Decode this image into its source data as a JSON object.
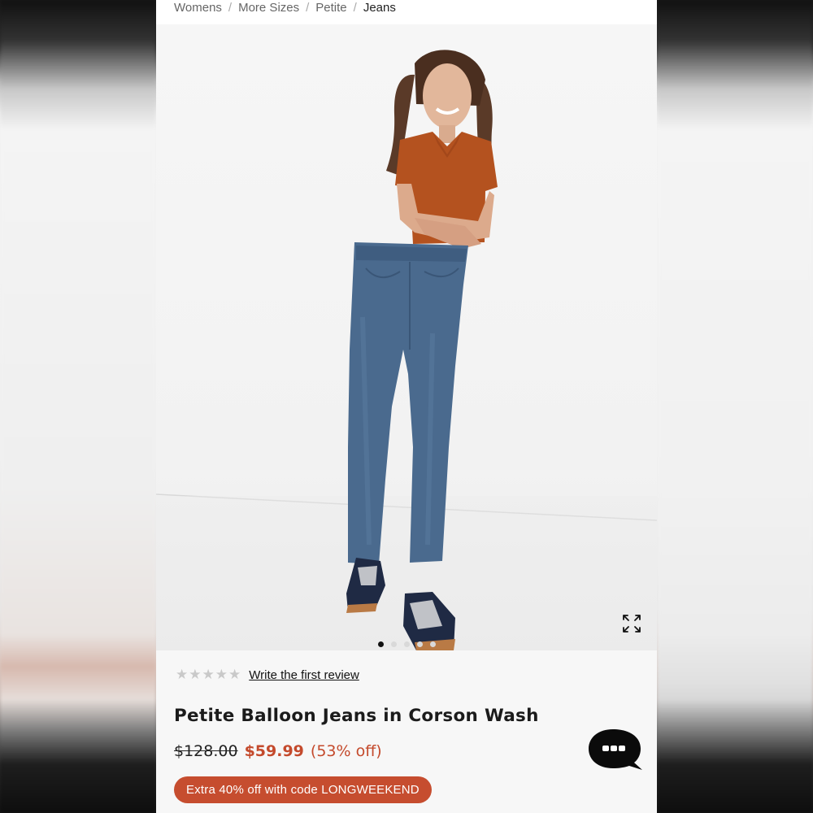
{
  "breadcrumb": {
    "items": [
      "Womens",
      "More Sizes",
      "Petite"
    ],
    "current": "Jeans"
  },
  "gallery": {
    "image_count": 5,
    "active_index": 0,
    "expand_icon": "expand-arrows-icon"
  },
  "product": {
    "review_link": "Write the first review",
    "rating_stars": 0,
    "title": "Petite Balloon Jeans in Corson Wash",
    "original_price": "$128.00",
    "sale_price": "$59.99",
    "discount": "(53% off)",
    "promo": "Extra 40% off with code LONGWEEKEND"
  },
  "chat": {
    "icon": "chat-bubble-icon"
  },
  "colors": {
    "accent": "#c44a2c",
    "promo_bg": "#c64d2f"
  }
}
